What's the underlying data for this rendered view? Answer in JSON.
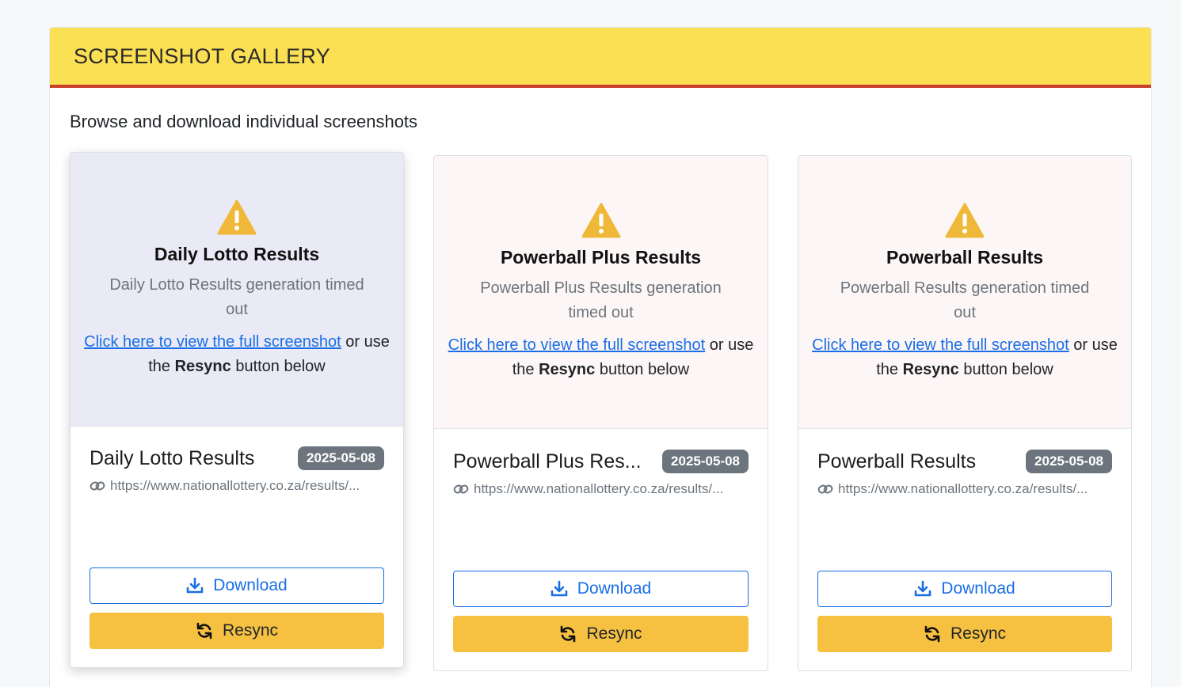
{
  "gallery": {
    "title": "SCREENSHOT GALLERY",
    "subtitle": "Browse and download individual screenshots"
  },
  "link_text": "Click here to view the full screenshot",
  "hint_middle": " or use the ",
  "hint_bold": "Resync",
  "hint_end": " button below",
  "cards": [
    {
      "title": "Daily Lotto Results",
      "message": "Daily Lotto Results generation timed out",
      "name": "Daily Lotto Results",
      "date": "2025-05-08",
      "url": "https://www.nationallottery.co.za/results/...",
      "download_label": "Download",
      "resync_label": "Resync"
    },
    {
      "title": "Powerball Plus Results",
      "message": "Powerball Plus Results generation timed out",
      "name": "Powerball Plus Res...",
      "date": "2025-05-08",
      "url": "https://www.nationallottery.co.za/results/...",
      "download_label": "Download",
      "resync_label": "Resync"
    },
    {
      "title": "Powerball Results",
      "message": "Powerball Results generation timed out",
      "name": "Powerball Results",
      "date": "2025-05-08",
      "url": "https://www.nationallottery.co.za/results/...",
      "download_label": "Download",
      "resync_label": "Resync"
    }
  ],
  "colors": {
    "header_bg": "#fce053",
    "header_border": "#c9412c",
    "warning": "#f0b838",
    "link": "#1a6ee6",
    "badge": "#6c757d",
    "resync": "#f6c141"
  },
  "icons": {
    "warning": "warning-triangle-icon",
    "link": "link-icon",
    "download": "download-icon",
    "resync": "resync-icon"
  }
}
